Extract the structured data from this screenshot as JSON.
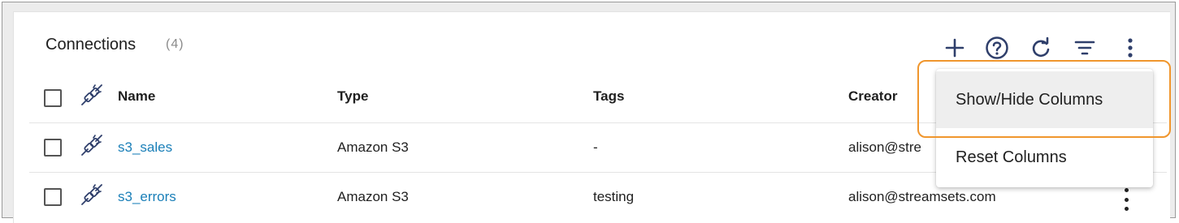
{
  "header": {
    "title": "Connections",
    "count": "(4)"
  },
  "toolbar": {
    "icons": [
      "add-icon",
      "help-icon",
      "refresh-icon",
      "filter-icon",
      "more-vert-icon"
    ]
  },
  "table": {
    "columns": [
      "Name",
      "Type",
      "Tags",
      "Creator"
    ],
    "rows": [
      {
        "name": "s3_sales",
        "type": "Amazon S3",
        "tags": "-",
        "creator": "alison@stre"
      },
      {
        "name": "s3_errors",
        "type": "Amazon S3",
        "tags": "testing",
        "creator": "alison@streamsets.com"
      }
    ]
  },
  "menu": {
    "items": [
      "Show/Hide Columns",
      "Reset Columns"
    ]
  },
  "colors": {
    "link": "#1a7fb8",
    "icon": "#2f3f6b",
    "highlight": "#f0962d"
  }
}
